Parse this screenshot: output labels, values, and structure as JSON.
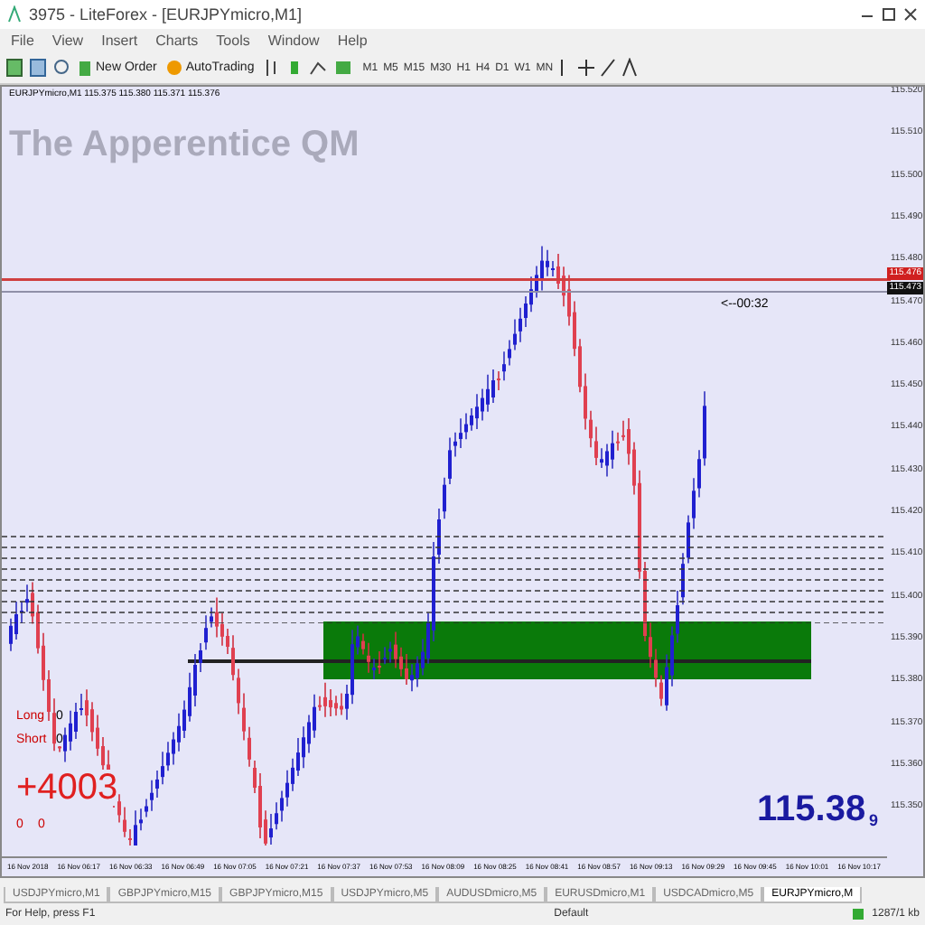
{
  "window": {
    "title": "3975 - LiteForex - [EURJPYmicro,M1]"
  },
  "menu": [
    "File",
    "View",
    "Insert",
    "Charts",
    "Tools",
    "Window",
    "Help"
  ],
  "toolbar": {
    "new_order": "New Order",
    "autotrading": "AutoTrading",
    "timeframes": [
      "M1",
      "M5",
      "M15",
      "M30",
      "H1",
      "H4",
      "D1",
      "W1",
      "MN"
    ]
  },
  "chart": {
    "header": "EURJPYmicro,M1 115.375 115.380 115.371 115.376",
    "overlay_title": "The Apperentice QM",
    "timer": "<--00:32",
    "long_label": "Long",
    "long_value": "0",
    "short_label": "Short",
    "short_value": "0",
    "profit": "+4003",
    "counts": [
      "0",
      "0"
    ],
    "price": "115.38",
    "price_suffix": "9",
    "price_axis": [
      "115.520",
      "115.510",
      "115.500",
      "115.490",
      "115.480",
      "115.470",
      "115.460",
      "115.450",
      "115.440",
      "115.430",
      "115.420",
      "115.410",
      "115.400",
      "115.390",
      "115.380",
      "115.370",
      "115.360",
      "115.350"
    ],
    "red_line_label": "115.476",
    "bid_label": "115.473",
    "time_axis": [
      "16 Nov 2018",
      "16 Nov 06:17",
      "16 Nov 06:33",
      "16 Nov 06:49",
      "16 Nov 07:05",
      "16 Nov 07:21",
      "16 Nov 07:37",
      "16 Nov 07:53",
      "16 Nov 08:09",
      "16 Nov 08:25",
      "16 Nov 08:41",
      "16 Nov 08:57",
      "16 Nov 09:13",
      "16 Nov 09:29",
      "16 Nov 09:45",
      "16 Nov 10:01",
      "16 Nov 10:17"
    ]
  },
  "tabs": [
    {
      "label": "USDJPYmicro,M1",
      "selected": false
    },
    {
      "label": "GBPJPYmicro,M15",
      "selected": false
    },
    {
      "label": "GBPJPYmicro,M15",
      "selected": false
    },
    {
      "label": "USDJPYmicro,M5",
      "selected": false
    },
    {
      "label": "AUDUSDmicro,M5",
      "selected": false
    },
    {
      "label": "EURUSDmicro,M1",
      "selected": false
    },
    {
      "label": "USDCADmicro,M5",
      "selected": false
    },
    {
      "label": "EURJPYmicro,M",
      "selected": true
    }
  ],
  "status_bar": {
    "help": "For Help, press F1",
    "profile": "Default",
    "traffic": "1287/1 kb"
  }
}
